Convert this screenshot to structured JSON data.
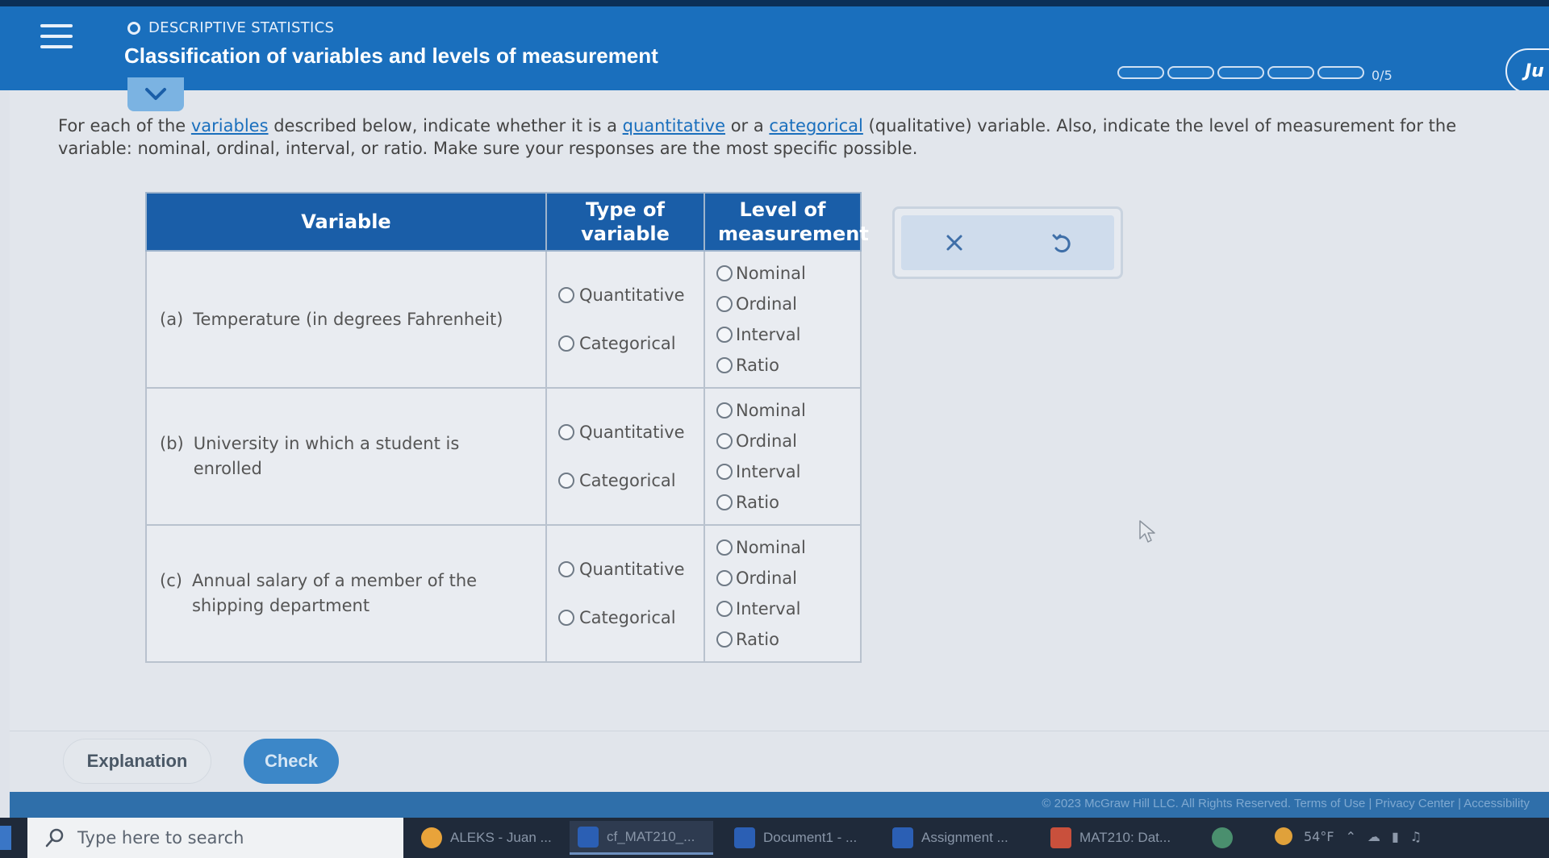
{
  "header": {
    "topic": "DESCRIPTIVE STATISTICS",
    "title": "Classification of variables and levels of measurement",
    "progress_total_segments": 5,
    "progress_completed": 0,
    "progress_label": "0/5",
    "jump_button_label": "Ju"
  },
  "instructions": {
    "part1": "For each of the ",
    "link_variables": "variables",
    "part2": " described below, indicate whether it is a ",
    "link_quantitative": "quantitative",
    "part3": " or a ",
    "link_categorical": "categorical",
    "part4": " (qualitative) variable. Also, indicate the level of measurement for the variable: nominal, ordinal, interval, or ratio. Make sure your responses are the most specific possible."
  },
  "table": {
    "headers": {
      "variable": "Variable",
      "type": "Type of variable",
      "level": "Level of measurement"
    },
    "type_options": [
      "Quantitative",
      "Categorical"
    ],
    "level_options": [
      "Nominal",
      "Ordinal",
      "Interval",
      "Ratio"
    ],
    "rows": [
      {
        "letter": "(a)",
        "description": "Temperature (in degrees Fahrenheit)"
      },
      {
        "letter": "(b)",
        "description": "University in which a student is enrolled"
      },
      {
        "letter": "(c)",
        "description": "Annual salary of a member of the shipping department"
      }
    ]
  },
  "actions": {
    "clear_icon": "close-icon",
    "undo_icon": "undo-icon"
  },
  "footer": {
    "explanation_label": "Explanation",
    "check_label": "Check",
    "copyright": "© 2023 McGraw Hill LLC. All Rights Reserved.   Terms of Use  |  Privacy Center  |  Accessibility"
  },
  "taskbar": {
    "search_placeholder": "Type here to search",
    "apps": [
      {
        "label": "ALEKS - Juan ...",
        "color": "#e8a33a"
      },
      {
        "label": "cf_MAT210_...",
        "color": "#2b5fb4"
      },
      {
        "label": "Document1 - ...",
        "color": "#2b5fb4"
      },
      {
        "label": "Assignment ...",
        "color": "#2b5fb4"
      },
      {
        "label": "MAT210: Dat...",
        "color": "#c9503c"
      }
    ],
    "weather": "54°F"
  },
  "colors": {
    "header_bg": "#1a6fbd",
    "table_header_bg": "#1a5ea8",
    "link": "#1a6fbd"
  }
}
